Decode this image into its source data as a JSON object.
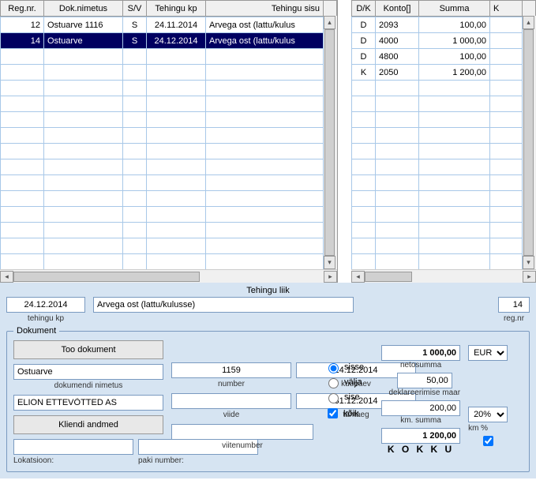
{
  "left_grid": {
    "headers": [
      "Reg.nr.",
      "Dok.nimetus",
      "S/V",
      "Tehingu kp",
      "Tehingu sisu"
    ],
    "rows": [
      {
        "reg": "12",
        "dok": "Ostuarve 1116",
        "sv": "S",
        "kp": "24.11.2014",
        "sisu": "Arvega ost (lattu/kulus",
        "selected": false
      },
      {
        "reg": "14",
        "dok": "Ostuarve",
        "sv": "S",
        "kp": "24.12.2014",
        "sisu": "Arvega ost (lattu/kulus",
        "selected": true
      }
    ],
    "empty_rows": 14
  },
  "right_grid": {
    "headers": [
      "D/K",
      "Konto[]",
      "Summa",
      "K"
    ],
    "rows": [
      {
        "dk": "D",
        "konto": "2093",
        "summa": "100,00"
      },
      {
        "dk": "D",
        "konto": "4000",
        "summa": "1 000,00"
      },
      {
        "dk": "D",
        "konto": "4800",
        "summa": "100,00"
      },
      {
        "dk": "K",
        "konto": "2050",
        "summa": "1 200,00"
      }
    ],
    "empty_rows": 12
  },
  "form": {
    "section_title": "Tehingu liik",
    "tehingu_kp": "24.12.2014",
    "tehingu_kp_label": "tehingu kp",
    "sisu": "Arvega ost (lattu/kulusse)",
    "reg_nr": "14",
    "reg_nr_label": "reg.nr",
    "dokument_legend": "Dokument",
    "too_dokument": "Too dokument",
    "dok_nimetus": "Ostuarve",
    "dok_nimetus_label": "dokumendi nimetus",
    "klient": "ELION ETTEVÕTTED AS",
    "kliendi_andmed": "Kliendi andmed",
    "lokatsioon_label": "Lokatsioon:",
    "paki_label": "paki number:",
    "number": "1159",
    "number_label": "number",
    "kuupaev": "24.12.2014",
    "kuupaev_label": "kuupäev",
    "viide": "",
    "viide_label": "viide",
    "tahtaeg": "31.12.2014",
    "tahtaeg_label": "tähtaeg",
    "viitenumber": "",
    "viitenumber_label": "viitenumber",
    "radio": {
      "sisse": "sisse",
      "valja": "välja",
      "sise": "sise",
      "koik": "kõik",
      "selected": "sisse",
      "koik_checked": true
    },
    "netosumma": "1 000,00",
    "netosumma_label": "netosumma",
    "dekl_maar": "50,00",
    "dekl_label": "deklareerimise maar",
    "km_summa": "200,00",
    "km_summa_label": "km. summa",
    "kokku": "1 200,00",
    "kokku_label": "K O K K U",
    "currency": "EUR",
    "km_pct": "20%",
    "km_pct_label": "km %"
  }
}
